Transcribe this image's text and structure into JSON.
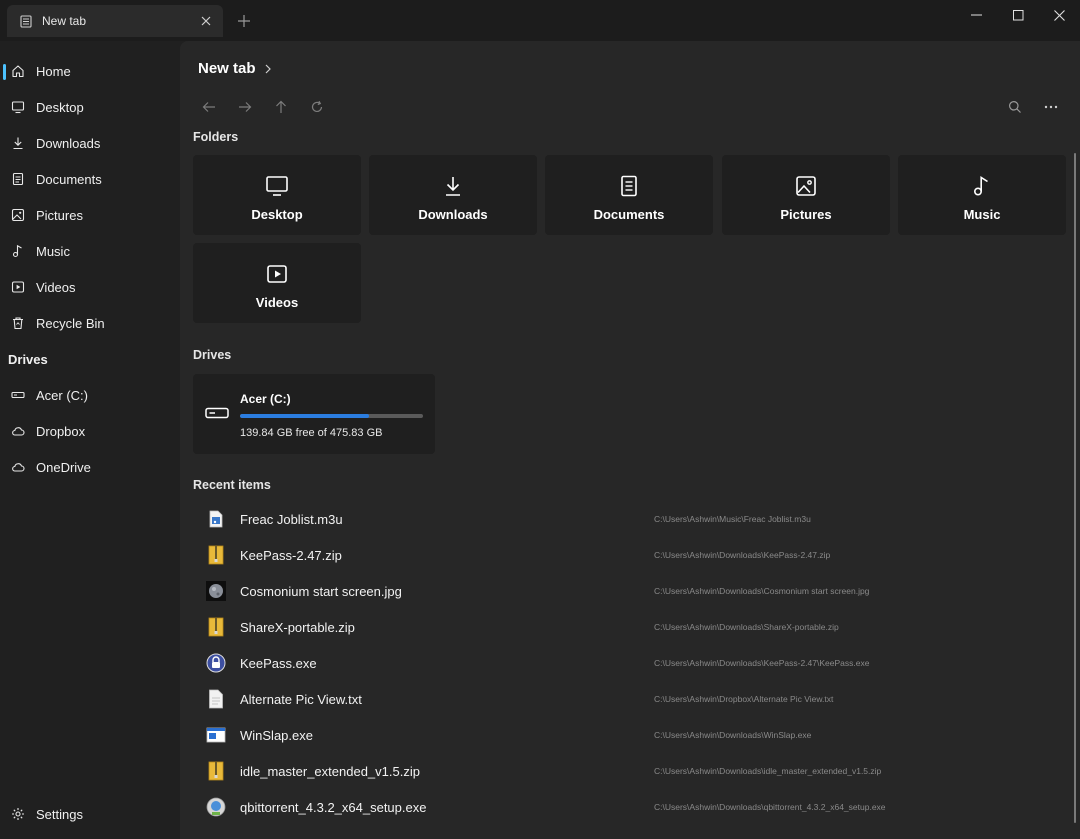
{
  "tab": {
    "label": "New tab"
  },
  "sidebar": {
    "items": [
      {
        "label": "Home",
        "icon": "home-icon"
      },
      {
        "label": "Desktop",
        "icon": "desktop-icon"
      },
      {
        "label": "Downloads",
        "icon": "download-icon"
      },
      {
        "label": "Documents",
        "icon": "document-icon"
      },
      {
        "label": "Pictures",
        "icon": "picture-icon"
      },
      {
        "label": "Music",
        "icon": "music-icon"
      },
      {
        "label": "Videos",
        "icon": "video-icon"
      },
      {
        "label": "Recycle Bin",
        "icon": "recycle-bin-icon"
      }
    ],
    "drives_header": "Drives",
    "drives": [
      {
        "label": "Acer (C:)",
        "icon": "drive-icon"
      },
      {
        "label": "Dropbox",
        "icon": "cloud-icon"
      },
      {
        "label": "OneDrive",
        "icon": "cloud-icon"
      }
    ],
    "settings_label": "Settings"
  },
  "main": {
    "breadcrumb": "New tab",
    "folders_title": "Folders",
    "folders": [
      {
        "label": "Desktop",
        "icon": "desktop-icon"
      },
      {
        "label": "Downloads",
        "icon": "download-icon"
      },
      {
        "label": "Documents",
        "icon": "document-icon"
      },
      {
        "label": "Pictures",
        "icon": "picture-icon"
      },
      {
        "label": "Music",
        "icon": "music-icon"
      },
      {
        "label": "Videos",
        "icon": "video-icon"
      }
    ],
    "drives_title": "Drives",
    "drive": {
      "name": "Acer (C:)",
      "free_text": "139.84 GB free of 475.83 GB",
      "used_fraction": 0.706
    },
    "recent_title": "Recent items",
    "recent": [
      {
        "name": "Freac Joblist.m3u",
        "path": "C:\\Users\\Ashwin\\Music\\Freac Joblist.m3u",
        "icon": "playlist-file-icon"
      },
      {
        "name": "KeePass-2.47.zip",
        "path": "C:\\Users\\Ashwin\\Downloads\\KeePass-2.47.zip",
        "icon": "zip-file-icon"
      },
      {
        "name": "Cosmonium start screen.jpg",
        "path": "C:\\Users\\Ashwin\\Downloads\\Cosmonium start screen.jpg",
        "icon": "image-thumbnail-icon"
      },
      {
        "name": "ShareX-portable.zip",
        "path": "C:\\Users\\Ashwin\\Downloads\\ShareX-portable.zip",
        "icon": "zip-file-icon"
      },
      {
        "name": "KeePass.exe",
        "path": "C:\\Users\\Ashwin\\Downloads\\KeePass-2.47\\KeePass.exe",
        "icon": "keepass-lock-icon"
      },
      {
        "name": "Alternate Pic View.txt",
        "path": "C:\\Users\\Ashwin\\Dropbox\\Alternate Pic View.txt",
        "icon": "text-file-icon"
      },
      {
        "name": "WinSlap.exe",
        "path": "C:\\Users\\Ashwin\\Downloads\\WinSlap.exe",
        "icon": "app-window-icon"
      },
      {
        "name": "idle_master_extended_v1.5.zip",
        "path": "C:\\Users\\Ashwin\\Downloads\\idle_master_extended_v1.5.zip",
        "icon": "zip-file-icon"
      },
      {
        "name": "qbittorrent_4.3.2_x64_setup.exe",
        "path": "C:\\Users\\Ashwin\\Downloads\\qbittorrent_4.3.2_x64_setup.exe",
        "icon": "installer-icon"
      }
    ]
  },
  "colors": {
    "accent": "#4cc2ff",
    "drive_bar": "#2b7de0",
    "zip": "#e8b93a"
  }
}
